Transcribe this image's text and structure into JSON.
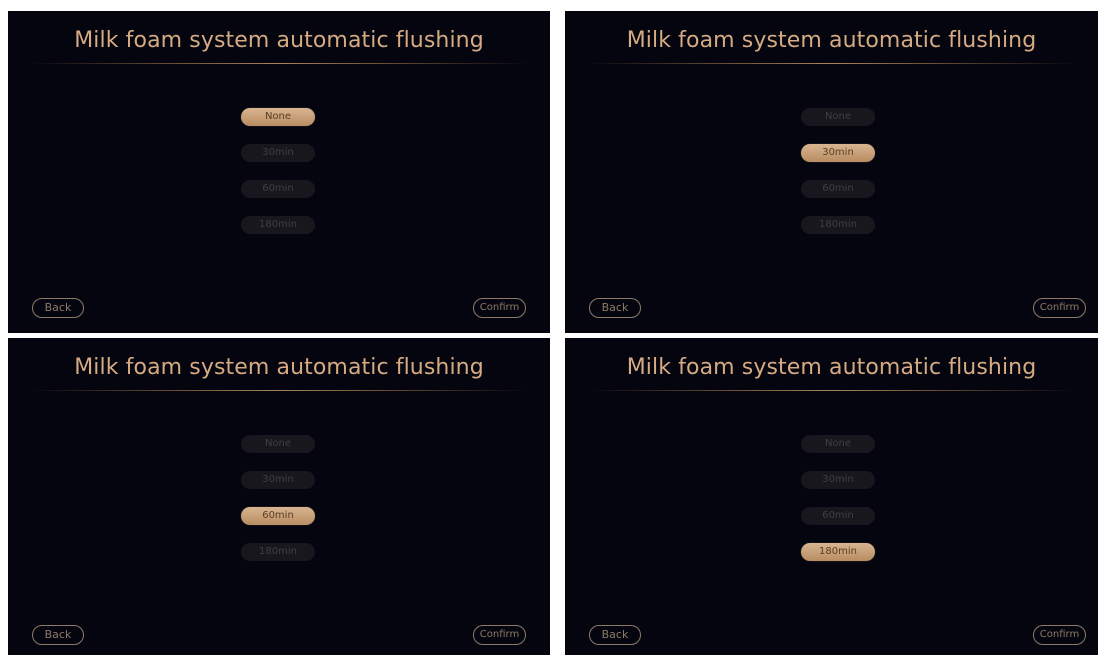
{
  "screen": {
    "title": "Milk foam system automatic flushing",
    "options": [
      "None",
      "30min",
      "60min",
      "180min"
    ],
    "back_label": "Back",
    "confirm_label": "Confirm"
  },
  "panels": [
    {
      "selected_option": "None"
    },
    {
      "selected_option": "30min"
    },
    {
      "selected_option": "60min"
    },
    {
      "selected_option": "180min"
    }
  ],
  "colors": {
    "background": "#04050f",
    "title_gold": "#d6aa82",
    "selected_fill": "#c9a077",
    "unselected_fill": "#17171d",
    "unselected_text": "#3e3e46",
    "outline_button": "#8d7a66"
  }
}
